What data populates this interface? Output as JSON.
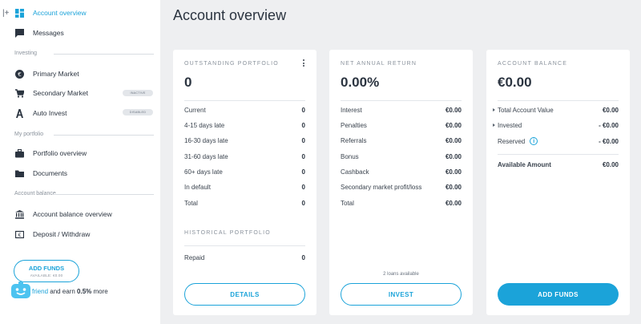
{
  "sidebar": {
    "collapse_glyph": "|+",
    "items_top": [
      {
        "label": "Account overview",
        "icon": "dashboard-icon"
      },
      {
        "label": "Messages",
        "icon": "chat-icon"
      }
    ],
    "sections": [
      {
        "label": "Investing",
        "items": [
          {
            "label": "Primary Market",
            "icon": "euro-icon"
          },
          {
            "label": "Secondary Market",
            "icon": "cart-icon",
            "badge": "INACTIVE"
          },
          {
            "label": "Auto Invest",
            "icon": "auto-icon",
            "badge": "DISABLED"
          }
        ]
      },
      {
        "label": "My portfolio",
        "items": [
          {
            "label": "Portfolio overview",
            "icon": "briefcase-icon"
          },
          {
            "label": "Documents",
            "icon": "folder-icon"
          }
        ]
      },
      {
        "label": "Account balance",
        "items": [
          {
            "label": "Account balance overview",
            "icon": "bank-icon"
          },
          {
            "label": "Deposit / Withdraw",
            "icon": "deposit-icon"
          }
        ]
      }
    ],
    "add_funds": {
      "label": "ADD FUNDS",
      "sub": "AVAILABLE: €0.00"
    },
    "invite": {
      "link": "friend",
      "text1": " and earn ",
      "bold": "0.5%",
      "text2": " more"
    }
  },
  "page": {
    "title": "Account overview"
  },
  "portfolio": {
    "title": "OUTSTANDING PORTFOLIO",
    "value": "0",
    "rows": [
      {
        "label": "Current",
        "value": "0"
      },
      {
        "label": "4-15 days late",
        "value": "0"
      },
      {
        "label": "16-30 days late",
        "value": "0"
      },
      {
        "label": "31-60 days late",
        "value": "0"
      },
      {
        "label": "60+ days late",
        "value": "0"
      },
      {
        "label": "In default",
        "value": "0"
      },
      {
        "label": "Total",
        "value": "0"
      }
    ],
    "historical_title": "HISTORICAL PORTFOLIO",
    "historical_rows": [
      {
        "label": "Repaid",
        "value": "0"
      }
    ],
    "button": "DETAILS"
  },
  "return": {
    "title": "NET ANNUAL RETURN",
    "value": "0.00%",
    "rows": [
      {
        "label": "Interest",
        "value": "€0.00"
      },
      {
        "label": "Penalties",
        "value": "€0.00"
      },
      {
        "label": "Referrals",
        "value": "€0.00"
      },
      {
        "label": "Bonus",
        "value": "€0.00"
      },
      {
        "label": "Cashback",
        "value": "€0.00"
      },
      {
        "label": "Secondary market profit/loss",
        "value": "€0.00"
      },
      {
        "label": "Total",
        "value": "€0.00"
      }
    ],
    "loans_available": "2 loans available",
    "button": "INVEST"
  },
  "balance": {
    "title": "ACCOUNT BALANCE",
    "value": "€0.00",
    "rows": [
      {
        "label": "Total Account Value",
        "value": "€0.00"
      },
      {
        "label": "Invested",
        "value": "- €0.00"
      },
      {
        "label": "Reserved",
        "value": "- €0.00"
      }
    ],
    "available": {
      "label": "Available Amount",
      "value": "€0.00"
    },
    "button": "ADD FUNDS"
  },
  "colors": {
    "accent": "#1ba3d9",
    "background": "#eeeff1",
    "text": "#2b3440"
  }
}
